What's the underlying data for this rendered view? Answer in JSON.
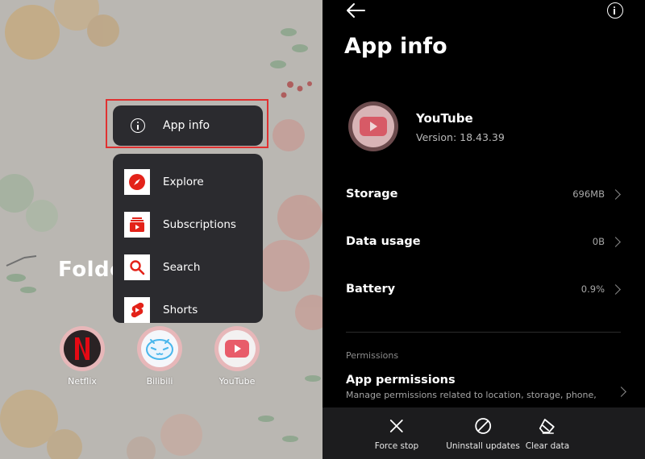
{
  "home": {
    "folder_label": "Folde",
    "popup": {
      "label": "App info",
      "icon": "info-icon"
    },
    "shortcuts": [
      {
        "label": "Explore",
        "icon": "compass-icon"
      },
      {
        "label": "Subscriptions",
        "icon": "subscriptions-icon"
      },
      {
        "label": "Search",
        "icon": "search-icon"
      },
      {
        "label": "Shorts",
        "icon": "shorts-icon"
      }
    ],
    "apps": [
      {
        "label": "Netflix",
        "icon": "netflix-icon"
      },
      {
        "label": "Bilibili",
        "icon": "bilibili-icon"
      },
      {
        "label": "YouTube",
        "icon": "youtube-icon"
      }
    ]
  },
  "app_info": {
    "title": "App info",
    "app_name": "YouTube",
    "version": "Version: 18.43.39",
    "rows": [
      {
        "label": "Storage",
        "value": "696MB"
      },
      {
        "label": "Data usage",
        "value": "0B"
      },
      {
        "label": "Battery",
        "value": "0.9%"
      }
    ],
    "section": "Permissions",
    "permissions": {
      "title": "App permissions",
      "subtitle": "Manage permissions related to location, storage, phone,"
    },
    "actions": [
      {
        "label": "Force stop",
        "icon": "close-icon"
      },
      {
        "label": "Uninstall updates",
        "icon": "block-icon"
      },
      {
        "label": "Clear data",
        "icon": "eraser-icon"
      }
    ]
  },
  "colors": {
    "accent_red": "#e03131",
    "youtube_red": "#ff0000",
    "menu_bg": "#2b2b2f",
    "bar_bg": "#1c1c1e"
  }
}
